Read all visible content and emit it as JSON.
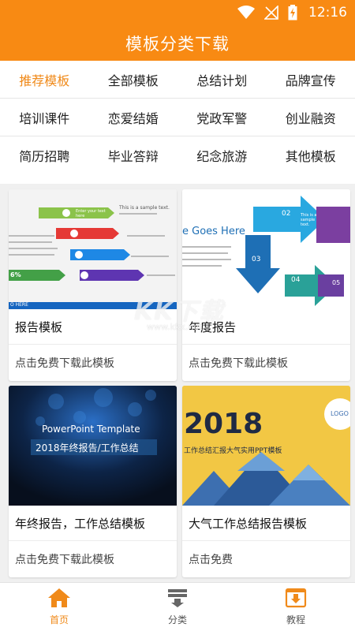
{
  "status_bar": {
    "time": "12:16",
    "icons": [
      "wifi-icon",
      "no-signal-icon",
      "battery-charging-icon"
    ]
  },
  "header": {
    "title": "模板分类下载"
  },
  "categories": [
    [
      "推荐模板",
      "全部模板",
      "总结计划",
      "品牌宣传"
    ],
    [
      "培训课件",
      "恋爱结婚",
      "党政军警",
      "创业融资"
    ],
    [
      "简历招聘",
      "毕业答辩",
      "纪念旅游",
      "其他模板"
    ]
  ],
  "active_category": "推荐模板",
  "cards": [
    {
      "name": "报告模板",
      "download_label": "点击免费下载此模板",
      "thumb": {
        "sample_text": "This is a sample text.",
        "enter_text": "Enter your text here",
        "percent": "6%",
        "footer": "O HERE"
      }
    },
    {
      "name": "年度报告",
      "download_label": "点击免费下载此模板",
      "thumb": {
        "heading": "e Goes Here",
        "numbers": [
          "02",
          "03",
          "04",
          "05"
        ],
        "sample_text": "This is a sample text."
      }
    },
    {
      "name": "年终报告，工作总结模板",
      "download_label": "点击免费下载此模板",
      "thumb": {
        "line1": "PowerPoint Template",
        "line2": "2018年终报告/工作总结"
      }
    },
    {
      "name": "大气工作总结报告模板",
      "download_label": "点击免费",
      "thumb": {
        "year": "2018",
        "subtitle": "工作总结汇报大气实用PPT模板",
        "logo": "LOGO"
      }
    }
  ],
  "watermark": {
    "brand": "KK下载",
    "url": "www.kkx.net"
  },
  "tabs": [
    {
      "label": "首页",
      "icon": "home-icon",
      "active": true
    },
    {
      "label": "分类",
      "icon": "category-icon",
      "active": false
    },
    {
      "label": "教程",
      "icon": "download-tutorial-icon",
      "active": false
    }
  ],
  "colors": {
    "brand_orange": "#f88a13",
    "active_text": "#f08a1a"
  }
}
